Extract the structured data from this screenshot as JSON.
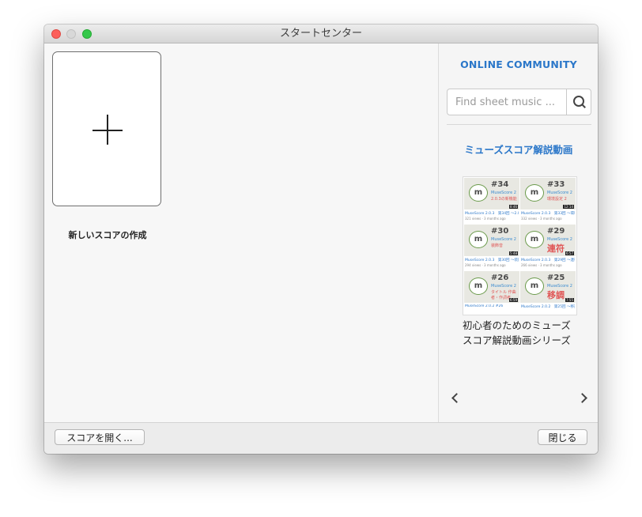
{
  "window": {
    "title": "スタートセンター"
  },
  "main": {
    "new_score_label": "新しいスコアの作成"
  },
  "sidebar": {
    "community_title": "ONLINE COMMUNITY",
    "search": {
      "placeholder": "Find sheet music ..."
    },
    "video_title": "ミューズスコア解説動画",
    "video_caption_line1": "初心者のためのミューズ",
    "video_caption_line2": "スコア解説動画シリーズ",
    "thumbnails": [
      {
        "num": "#34",
        "sub": "MuseScore 2",
        "sub2": "2.0.3の新機能",
        "dur": "8:46",
        "cap": "MuseScore 2.0.3　第34回 〜2.0.3新機能〜",
        "views": "321 views · 3 months ago"
      },
      {
        "num": "#33",
        "sub": "MuseScore 2",
        "sub2": "環境設定 2",
        "dur": "12:14",
        "cap": "MuseScore 2.0.3　第33回 〜環境設定2〜",
        "views": "332 views · 3 months ago"
      },
      {
        "num": "#30",
        "sub": "MuseScore 2",
        "sub2": "装飾音",
        "dur": "5:48",
        "cap": "MuseScore 2.0.3　第30回 〜装飾音〜",
        "views": "294 views · 3 months ago"
      },
      {
        "num": "#29",
        "sub": "MuseScore 2",
        "big": "連符",
        "dur": "6:57",
        "cap": "MuseScore 2.0.3　第29回 〜連符〜",
        "views": "266 views · 3 months ago"
      },
      {
        "num": "#26",
        "sub": "MuseScore 2",
        "sub2": "タイトル 作曲者・作詞者",
        "dur": "6:59",
        "cap": "MuseScore 2.0.2 #26",
        "views": ""
      },
      {
        "num": "#25",
        "sub": "MuseScore 2",
        "big": "移調",
        "dur": "7:55",
        "cap": "MuseScore 2.0.2　第25回 〜移調〜",
        "views": ""
      }
    ]
  },
  "footer": {
    "open_label": "スコアを開く...",
    "close_label": "閉じる"
  }
}
